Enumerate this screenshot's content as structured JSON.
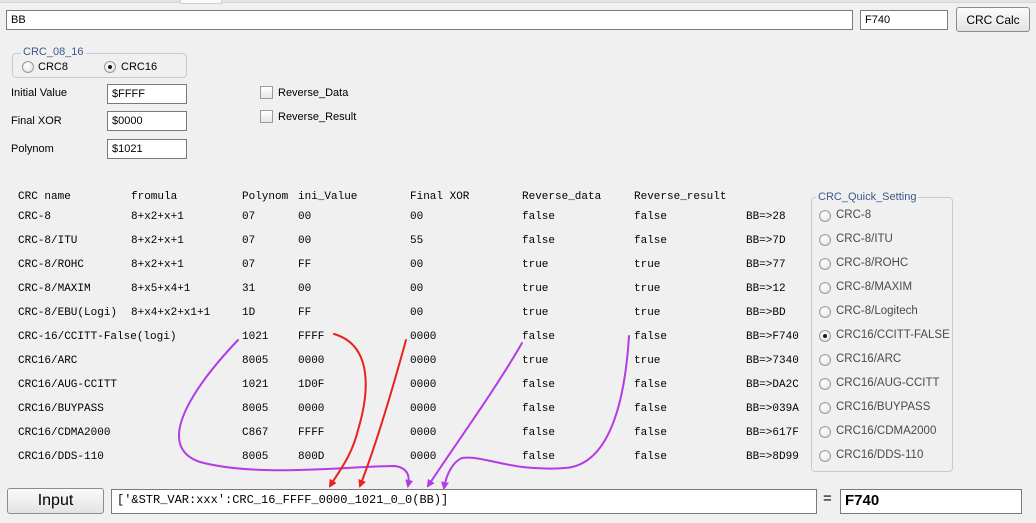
{
  "top": {
    "input_value": "BB",
    "result_value": "F740",
    "calc_button_label": "CRC Calc"
  },
  "crc_width": {
    "legend": "CRC_08_16",
    "options": [
      "CRC8",
      "CRC16"
    ],
    "selected": "CRC16"
  },
  "params": {
    "initial_label": "Initial Value",
    "initial_value": "$FFFF",
    "final_xor_label": "Final XOR",
    "final_xor_value": "$0000",
    "polynom_label": "Polynom",
    "polynom_value": "$1021"
  },
  "options": {
    "reverse_data_label": "Reverse_Data",
    "reverse_data_checked": false,
    "reverse_result_label": "Reverse_Result",
    "reverse_result_checked": false
  },
  "table": {
    "headers": [
      "CRC name",
      "fromula",
      "Polynom",
      "ini_Value",
      "Final XOR",
      "Reverse_data",
      "Reverse_result"
    ],
    "rows": [
      [
        "CRC-8",
        "8+x2+x+1",
        "07",
        "00",
        "00",
        "false",
        "false",
        "BB=>28"
      ],
      [
        "CRC-8/ITU",
        "8+x2+x+1",
        "07",
        "00",
        "55",
        "false",
        "false",
        "BB=>7D"
      ],
      [
        "CRC-8/ROHC",
        "8+x2+x+1",
        "07",
        "FF",
        "00",
        "true",
        "true",
        "BB=>77"
      ],
      [
        "CRC-8/MAXIM",
        "8+x5+x4+1",
        "31",
        "00",
        "00",
        "true",
        "true",
        "BB=>12"
      ],
      [
        "CRC-8/EBU(Logi)",
        "8+x4+x2+x1+1",
        "1D",
        "FF",
        "00",
        "true",
        "true",
        "BB=>BD"
      ],
      [
        "CRC-16/CCITT-False(logi)",
        "",
        "1021",
        "FFFF",
        "0000",
        "false",
        "false",
        "BB=>F740"
      ],
      [
        "CRC16/ARC",
        "",
        "8005",
        "0000",
        "0000",
        "true",
        "true",
        "BB=>7340"
      ],
      [
        "CRC16/AUG-CCITT",
        "",
        "1021",
        "1D0F",
        "0000",
        "false",
        "false",
        "BB=>DA2C"
      ],
      [
        "CRC16/BUYPASS",
        "",
        "8005",
        "0000",
        "0000",
        "false",
        "false",
        "BB=>039A"
      ],
      [
        "CRC16/CDMA2000",
        "",
        "C867",
        "FFFF",
        "0000",
        "false",
        "false",
        "BB=>617F"
      ],
      [
        "CRC16/DDS-110",
        "",
        "8005",
        "800D",
        "0000",
        "false",
        "false",
        "BB=>8D99"
      ]
    ]
  },
  "quick_setting": {
    "legend": "CRC_Quick_Setting",
    "options": [
      "CRC-8",
      "CRC-8/ITU",
      "CRC-8/ROHC",
      "CRC-8/MAXIM",
      "CRC-8/Logitech",
      "CRC16/CCITT-FALSE",
      "CRC16/ARC",
      "CRC16/AUG-CCITT",
      "CRC16/BUYPASS",
      "CRC16/CDMA2000",
      "CRC16/DDS-110"
    ],
    "selected": "CRC16/CCITT-FALSE"
  },
  "bottom": {
    "input_button_label": "Input",
    "expression": "['&STR_VAR:xxx':CRC_16_FFFF_0000_1021_0_0(BB)]",
    "equals": "=",
    "output_value": "F740"
  },
  "annotation_colors": {
    "red": "#e8231f",
    "purple": "#b43be6"
  }
}
